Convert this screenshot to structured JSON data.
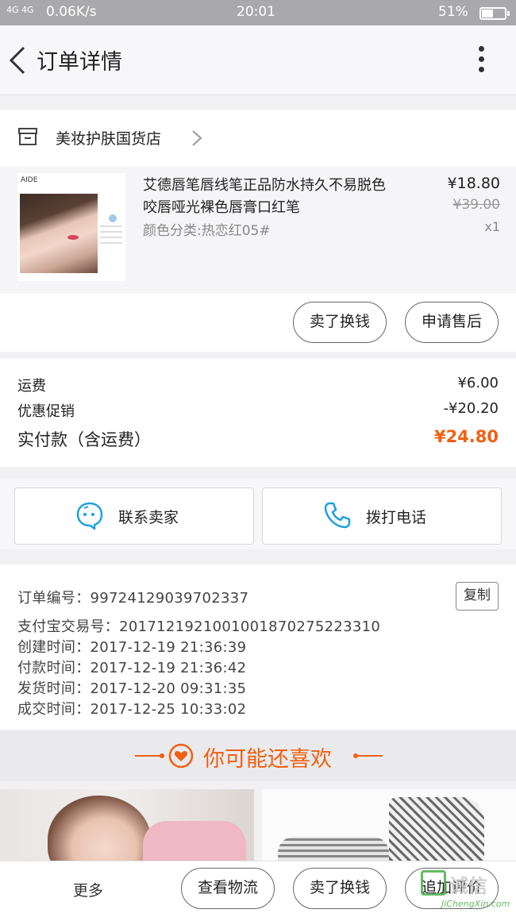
{
  "status_bar": {
    "signal": "4G 4G",
    "speed": "0.06K/s",
    "time": "20:01",
    "battery": "51%",
    "battery_level": 0.51
  },
  "nav": {
    "title": "订单详情"
  },
  "shop": {
    "name": "美妆护肤国货店"
  },
  "product": {
    "brand": "AIDE",
    "title": "艾德唇笔唇线笔正品防水持久不易脱色咬唇哑光裸色唇膏口红笔",
    "spec": "颜色分类:热恋红05#",
    "price": "¥18.80",
    "original_price": "¥39.00",
    "quantity": "x1"
  },
  "item_actions": {
    "resell": "卖了换钱",
    "after_sale": "申请售后"
  },
  "fees": {
    "shipping_label": "运费",
    "shipping_value": "¥6.00",
    "discount_label": "优惠促销",
    "discount_value": "-¥20.20",
    "paid_label": "实付款（含运费）",
    "paid_value": "¥24.80"
  },
  "contact": {
    "seller": "联系卖家",
    "phone": "拨打电话"
  },
  "order_info": {
    "order_no": "订单编号：99724129039702337",
    "copy": "复制",
    "alipay_no": "支付宝交易号：2017121921001001870275223310",
    "created": "创建时间：2017-12-19 21:36:39",
    "paid": "付款时间：2017-12-19 21:36:42",
    "shipped": "发货时间：2017-12-20 09:31:35",
    "completed": "成交时间：2017-12-25 10:33:02"
  },
  "recommend": {
    "title": "你可能还喜欢"
  },
  "bottom_bar": {
    "more": "更多",
    "logistics": "查看物流",
    "resell": "卖了换钱",
    "review": "追加评价"
  },
  "watermark": {
    "text": "诚信",
    "sub": "JiChengXin.com"
  },
  "colors": {
    "accent": "#f06010",
    "icon_blue": "#1ea0e0"
  }
}
